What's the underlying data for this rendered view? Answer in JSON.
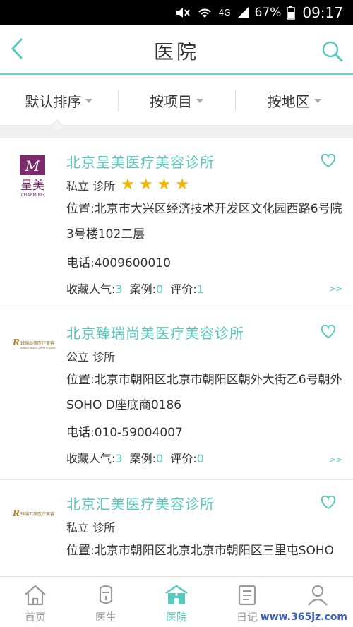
{
  "status_bar": {
    "battery": "67%",
    "time": "09:17",
    "network": "4G"
  },
  "header": {
    "title": "医院"
  },
  "filters": [
    {
      "label": "默认排序"
    },
    {
      "label": "按项目"
    },
    {
      "label": "按地区"
    }
  ],
  "hospitals": [
    {
      "name": "北京呈美医疗美容诊所",
      "type": "私立 诊所",
      "stars": 4,
      "address": "位置:北京市大兴区经济技术开发区文化园西路6号院3号楼102二层",
      "phone": "电话:4009600010",
      "favorites_label": "收藏人气:",
      "favorites": "3",
      "cases_label": "案例:",
      "cases": "0",
      "reviews_label": "评价:",
      "reviews": "1",
      "logo_text": "呈美",
      "logo_sub": "CHARMING",
      "logo_letter": "M"
    },
    {
      "name": "北京臻瑞尚美医疗美容诊所",
      "type": "公立 诊所",
      "address": "位置:北京市朝阳区北京市朝阳区朝外大街乙6号朝外SOHO D座底商0186",
      "phone": "电话:010-59004007",
      "favorites_label": "收藏人气:",
      "favorites": "3",
      "cases_label": "案例:",
      "cases": "0",
      "reviews_label": "评价:",
      "reviews": "0",
      "logo_text": "臻瑞尚美医疗美容",
      "logo_sub": "ZHENRUI MEDICAL AESTHETIC GROUP"
    },
    {
      "name": "北京汇美医疗美容诊所",
      "type": "私立 诊所",
      "address": "位置:北京市朝阳区北京北京市朝阳区三里屯SOHO",
      "logo_text": "臻瑞汇美医疗美容"
    }
  ],
  "more_label": ">>",
  "bottom_nav": [
    {
      "label": "首页",
      "icon": "home-icon"
    },
    {
      "label": "医生",
      "icon": "doctor-icon"
    },
    {
      "label": "医院",
      "icon": "hospital-icon",
      "active": true
    },
    {
      "label": "日记",
      "icon": "diary-icon"
    },
    {
      "label": "我的",
      "icon": "user-icon"
    }
  ],
  "watermark": "www.365jz.com",
  "colors": {
    "accent": "#59c9bd",
    "star": "#f4b400"
  }
}
